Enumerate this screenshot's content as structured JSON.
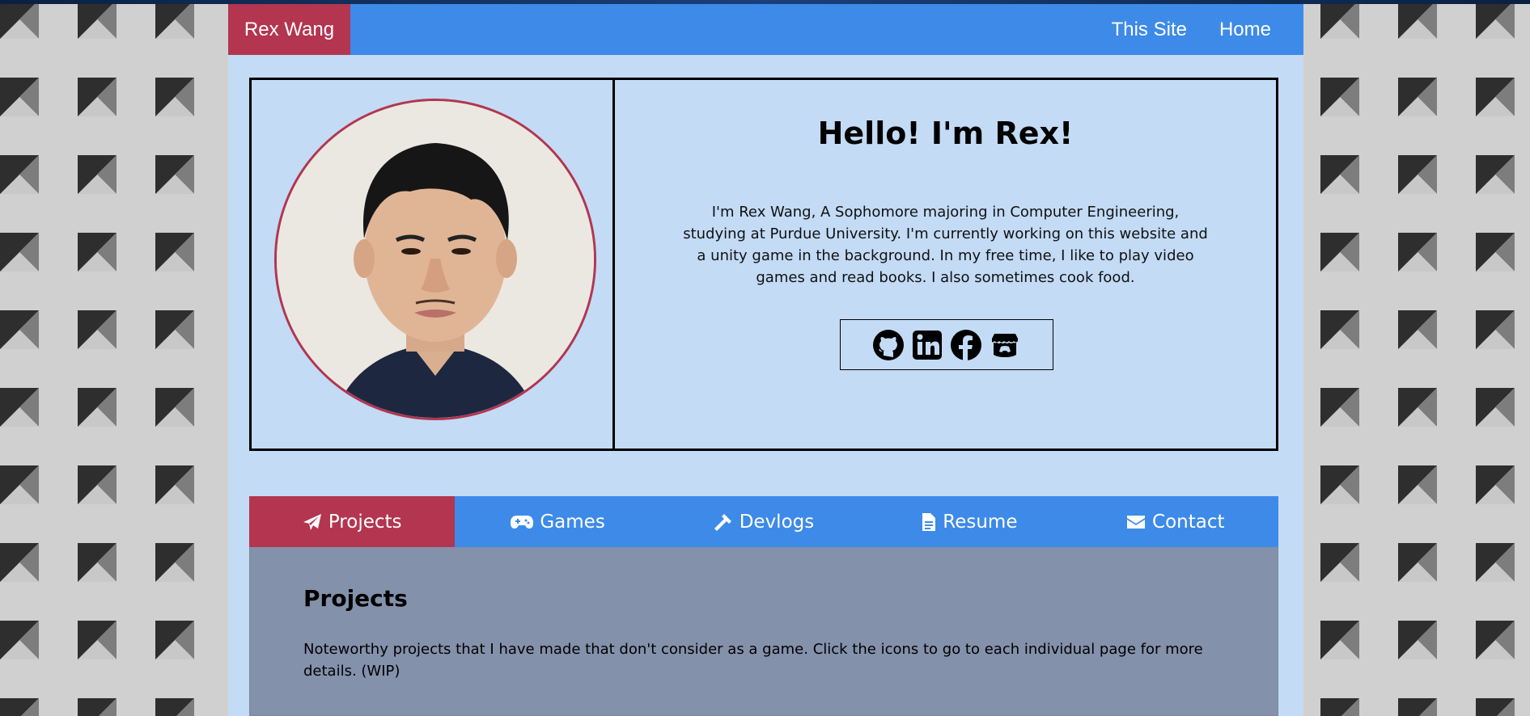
{
  "nav": {
    "brand": "Rex Wang",
    "links": [
      "This Site",
      "Home"
    ]
  },
  "hero": {
    "title": "Hello! I'm Rex!",
    "bio": "I'm Rex Wang, A Sophomore majoring in Computer Engineering, studying at Purdue University. I'm currently working on this website and a unity game in the background. In my free time, I like to play video games and read books. I also sometimes cook food.",
    "socials": [
      "github-icon",
      "linkedin-icon",
      "facebook-icon",
      "itchio-icon"
    ]
  },
  "tabs": [
    {
      "label": "Projects",
      "icon": "paper-plane-icon",
      "active": true
    },
    {
      "label": "Games",
      "icon": "gamepad-icon",
      "active": false
    },
    {
      "label": "Devlogs",
      "icon": "hammer-icon",
      "active": false
    },
    {
      "label": "Resume",
      "icon": "document-icon",
      "active": false
    },
    {
      "label": "Contact",
      "icon": "envelope-icon",
      "active": false
    }
  ],
  "panel": {
    "title": "Projects",
    "text": "Noteworthy projects that I have made that don't consider as a game. Click the icons to go to each individual page for more details. (WIP)"
  },
  "colors": {
    "accent": "#b3354f",
    "nav_blue": "#3d8ae8",
    "page_bg": "#c3dbf5",
    "panel_bg": "#8491ab"
  }
}
